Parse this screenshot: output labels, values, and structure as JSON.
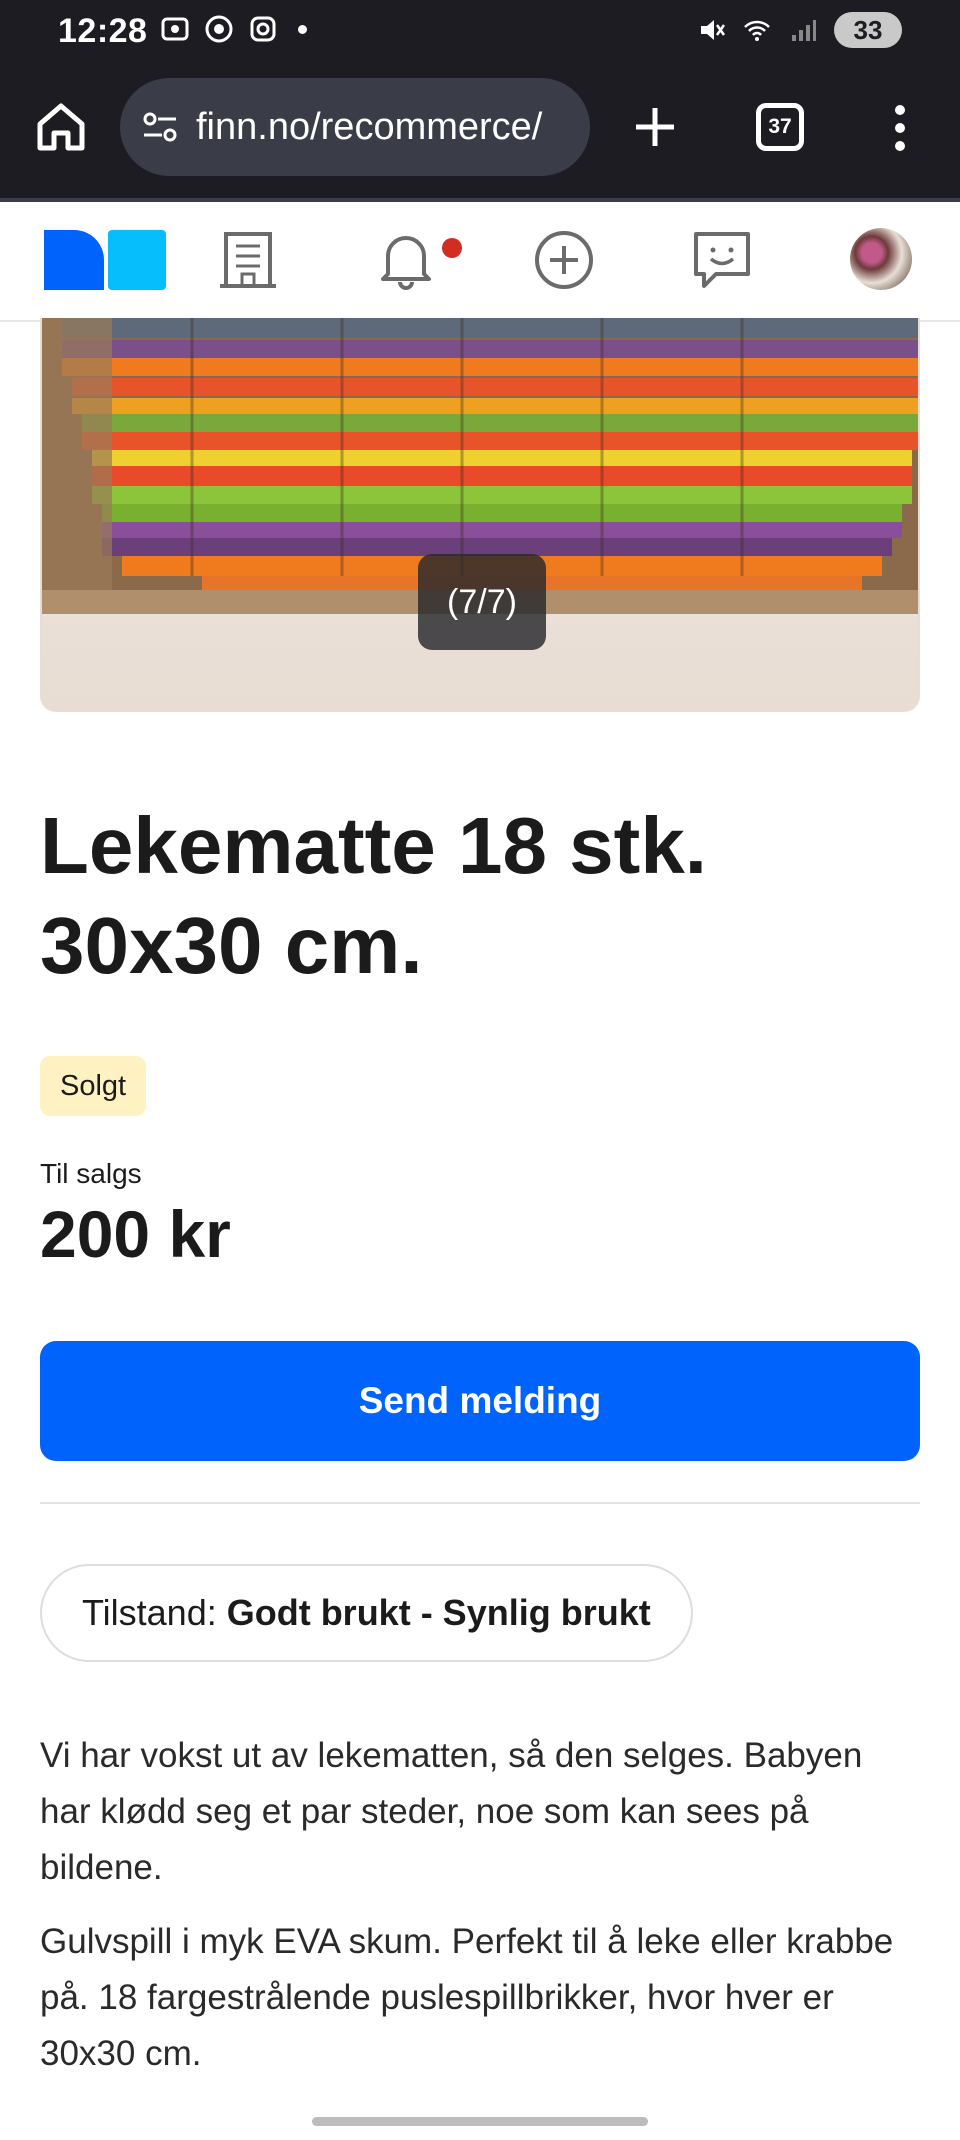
{
  "status_bar": {
    "time": "12:28",
    "battery": "33",
    "icons_left": [
      "screenshot-icon",
      "chrome-icon",
      "instagram-icon",
      "notification-dot-icon"
    ],
    "icons_right": [
      "mute-icon",
      "wifi-icon",
      "signal-icon",
      "battery-icon"
    ]
  },
  "browser": {
    "url": "finn.no/recommerce/",
    "tab_count": "37",
    "icons": [
      "home-icon",
      "site-settings-icon",
      "new-tab-icon",
      "tabs-icon",
      "more-menu-icon"
    ]
  },
  "app_nav": {
    "icons": [
      "finn-logo",
      "building-icon",
      "bell-icon",
      "add-listing-icon",
      "messages-icon",
      "avatar"
    ],
    "notification_dot_color": "#d12d23"
  },
  "gallery": {
    "counter": "(7/7)"
  },
  "listing": {
    "title": "Lekematte 18 stk. 30x30 cm.",
    "status_badge": "Solgt",
    "sale_label": "Til salgs",
    "price": "200 kr",
    "send_button": "Send melding",
    "condition_label": "Tilstand:",
    "condition_value": "Godt brukt - Synlig brukt",
    "description": [
      "Vi har vokst ut av lekematten, så den selges. Babyen har klødd seg et par steder, noe som kan sees på bildene.",
      "Gulvspill i myk EVA skum. Perfekt til å leke eller krabbe på. 18 fargestrålende puslespillbrikker, hvor hver er 30x30 cm."
    ]
  },
  "colors": {
    "primary_button": "#0063fb",
    "badge_bg": "#fff2c2",
    "system_bar": "#1c1c22",
    "logo_dark": "#0063fb",
    "logo_light": "#06befb"
  }
}
